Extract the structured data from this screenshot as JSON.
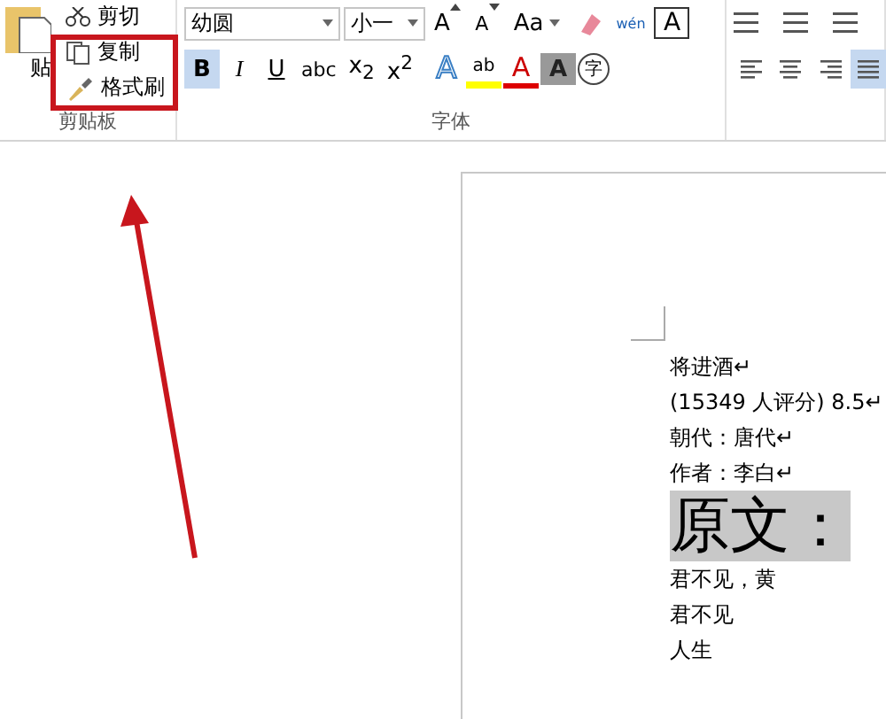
{
  "ribbon": {
    "clipboard": {
      "paste": "贴",
      "items": [
        {
          "label": "剪切",
          "kind": "cut"
        },
        {
          "label": "复制",
          "kind": "copy"
        },
        {
          "label": "格式刷",
          "kind": "painter"
        }
      ],
      "group_label": "剪贴板"
    },
    "font": {
      "font_name": "幼圆",
      "font_size": "小一",
      "row1": [
        {
          "label": "A",
          "kind": "grow"
        },
        {
          "label": "A",
          "kind": "shrink"
        },
        {
          "label": "Aa",
          "kind": "case"
        },
        {
          "kind": "eraser"
        },
        {
          "label": "wén",
          "kind": "phonetic"
        },
        {
          "label": "A",
          "kind": "border"
        }
      ],
      "formats": [
        {
          "label": "B",
          "selected": true,
          "kind": "bold"
        },
        {
          "label": "I",
          "selected": false,
          "kind": "italic"
        },
        {
          "label": "U",
          "selected": false,
          "kind": "underline"
        },
        {
          "label": "abc",
          "selected": false,
          "kind": "strike"
        },
        {
          "label": "x$_{2}$",
          "selected": false,
          "kind": "plain"
        },
        {
          "label": "x$^{2}$",
          "selected": false,
          "kind": "plain"
        }
      ],
      "effects": [
        {
          "label": "A",
          "kind": "outline"
        },
        {
          "label": "ab",
          "kind": "highlight"
        },
        {
          "label": "A",
          "kind": "color"
        },
        {
          "label": "A",
          "kind": "shade"
        },
        {
          "label": "字",
          "kind": "circle"
        }
      ],
      "group_label": "字体"
    },
    "paragraph": {
      "aligns": [
        {
          "kind": "left",
          "selected": false
        },
        {
          "kind": "center",
          "selected": false
        },
        {
          "kind": "right",
          "selected": false
        },
        {
          "kind": "justify",
          "selected": true
        }
      ]
    }
  },
  "document": {
    "lines": [
      {
        "text": "将进酒↵",
        "kind": "normal"
      },
      {
        "text": "(15349 人评分) 8.5↵",
        "kind": "normal"
      },
      {
        "text": "朝代：唐代↵",
        "kind": "normal"
      },
      {
        "text": "作者：李白↵",
        "kind": "normal"
      },
      {
        "text": "原文：",
        "kind": "heading"
      },
      {
        "text": "君不见，黄",
        "kind": "normal"
      },
      {
        "text": "君不见",
        "kind": "normal"
      },
      {
        "text": "人生",
        "kind": "normal"
      }
    ]
  },
  "annotation": {
    "highlight_box": true,
    "arrow": true
  }
}
